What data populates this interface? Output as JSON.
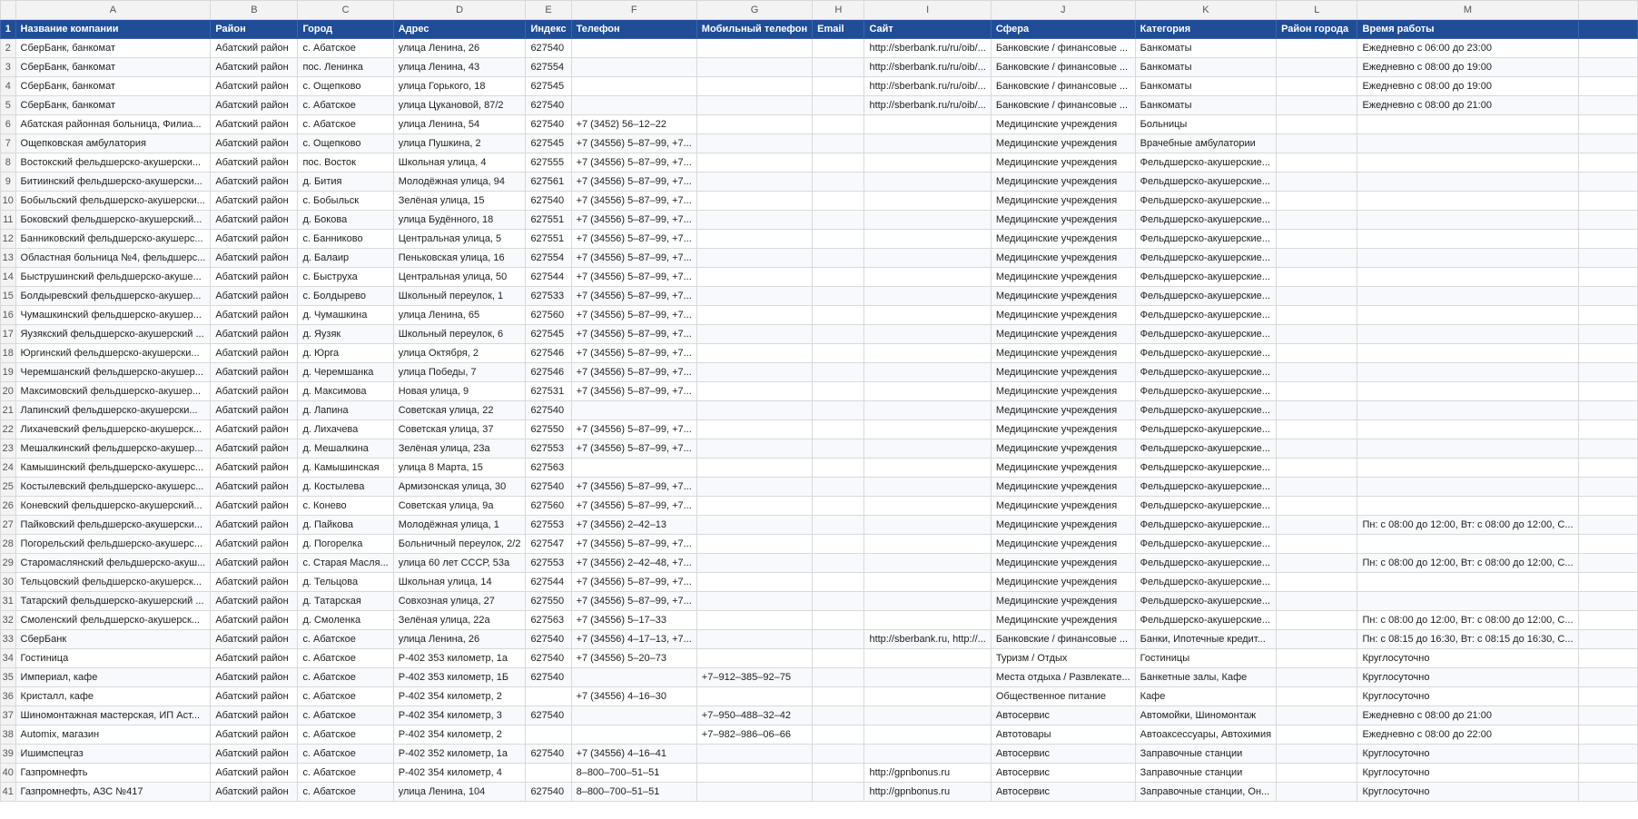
{
  "columns": [
    "A",
    "B",
    "C",
    "D",
    "E",
    "F",
    "G",
    "H",
    "I",
    "J",
    "K",
    "L",
    "M"
  ],
  "header_row": {
    "num": "1",
    "cells": [
      "Название компании",
      "Район",
      "Город",
      "Адрес",
      "Индекс",
      "Телефон",
      "Мобильный телефон",
      "Email",
      "Сайт",
      "Сфера",
      "Категория",
      "Район города",
      "Время работы"
    ]
  },
  "rows": [
    {
      "num": "2",
      "cells": [
        "СберБанк, банкомат",
        "Абатский район",
        "с. Абатское",
        "улица Ленина, 26",
        "627540",
        "",
        "",
        "",
        "http://sberbank.ru/ru/oib/...",
        "Банковские / финансовые ...",
        "Банкоматы",
        "",
        "Ежедневно с 06:00 до 23:00"
      ]
    },
    {
      "num": "3",
      "cells": [
        "СберБанк, банкомат",
        "Абатский район",
        "пос. Ленинка",
        "улица Ленина, 43",
        "627554",
        "",
        "",
        "",
        "http://sberbank.ru/ru/oib/...",
        "Банковские / финансовые ...",
        "Банкоматы",
        "",
        "Ежедневно с 08:00 до 19:00"
      ]
    },
    {
      "num": "4",
      "cells": [
        "СберБанк, банкомат",
        "Абатский район",
        "с. Ощепково",
        "улица Горького, 18",
        "627545",
        "",
        "",
        "",
        "http://sberbank.ru/ru/oib/...",
        "Банковские / финансовые ...",
        "Банкоматы",
        "",
        "Ежедневно с 08:00 до 19:00"
      ]
    },
    {
      "num": "5",
      "cells": [
        "СберБанк, банкомат",
        "Абатский район",
        "с. Абатское",
        "улица Цукановой, 87/2",
        "627540",
        "",
        "",
        "",
        "http://sberbank.ru/ru/oib/...",
        "Банковские / финансовые ...",
        "Банкоматы",
        "",
        "Ежедневно с 08:00 до 21:00"
      ]
    },
    {
      "num": "6",
      "cells": [
        "Абатская районная больница, Филиа...",
        "Абатский район",
        "с. Абатское",
        "улица Ленина, 54",
        "627540",
        "+7 (3452) 56–12–22",
        "",
        "",
        "",
        "Медицинские учреждения",
        "Больницы",
        "",
        ""
      ]
    },
    {
      "num": "7",
      "cells": [
        "Ощепковская амбулатория",
        "Абатский район",
        "с. Ощепково",
        "улица Пушкина, 2",
        "627545",
        "+7 (34556) 5–87–99, +7...",
        "",
        "",
        "",
        "Медицинские учреждения",
        "Врачебные амбулатории",
        "",
        ""
      ]
    },
    {
      "num": "8",
      "cells": [
        "Востокский фельдшерско-акушерски...",
        "Абатский район",
        "пос. Восток",
        "Школьная улица, 4",
        "627555",
        "+7 (34556) 5–87–99, +7...",
        "",
        "",
        "",
        "Медицинские учреждения",
        "Фельдшерско-акушерские...",
        "",
        ""
      ]
    },
    {
      "num": "9",
      "cells": [
        "Битиинский фельдшерско-акушерски...",
        "Абатский район",
        "д. Бития",
        "Молодёжная улица, 94",
        "627561",
        "+7 (34556) 5–87–99, +7...",
        "",
        "",
        "",
        "Медицинские учреждения",
        "Фельдшерско-акушерские...",
        "",
        ""
      ]
    },
    {
      "num": "10",
      "cells": [
        "Бобыльский фельдшерско-акушерски...",
        "Абатский район",
        "с. Бобыльск",
        "Зелёная улица, 15",
        "627540",
        "+7 (34556) 5–87–99, +7...",
        "",
        "",
        "",
        "Медицинские учреждения",
        "Фельдшерско-акушерские...",
        "",
        ""
      ]
    },
    {
      "num": "11",
      "cells": [
        "Боковский фельдшерско-акушерский...",
        "Абатский район",
        "д. Бокова",
        "улица Будённого, 18",
        "627551",
        "+7 (34556) 5–87–99, +7...",
        "",
        "",
        "",
        "Медицинские учреждения",
        "Фельдшерско-акушерские...",
        "",
        ""
      ]
    },
    {
      "num": "12",
      "cells": [
        "Банниковский фельдшерско-акушерс...",
        "Абатский район",
        "с. Банниково",
        "Центральная улица, 5",
        "627551",
        "+7 (34556) 5–87–99, +7...",
        "",
        "",
        "",
        "Медицинские учреждения",
        "Фельдшерско-акушерские...",
        "",
        ""
      ]
    },
    {
      "num": "13",
      "cells": [
        "Областная больница №4, фельдшерс...",
        "Абатский район",
        "д. Балаир",
        "Пеньковская улица, 16",
        "627554",
        "+7 (34556) 5–87–99, +7...",
        "",
        "",
        "",
        "Медицинские учреждения",
        "Фельдшерско-акушерские...",
        "",
        ""
      ]
    },
    {
      "num": "14",
      "cells": [
        "Быструшинский фельдшерско-акуше...",
        "Абатский район",
        "с. Быструха",
        "Центральная улица, 50",
        "627544",
        "+7 (34556) 5–87–99, +7...",
        "",
        "",
        "",
        "Медицинские учреждения",
        "Фельдшерско-акушерские...",
        "",
        ""
      ]
    },
    {
      "num": "15",
      "cells": [
        "Болдыревский фельдшерско-акушер...",
        "Абатский район",
        "с. Болдырево",
        "Школьный переулок, 1",
        "627533",
        "+7 (34556) 5–87–99, +7...",
        "",
        "",
        "",
        "Медицинские учреждения",
        "Фельдшерско-акушерские...",
        "",
        ""
      ]
    },
    {
      "num": "16",
      "cells": [
        "Чумашкинский фельдшерско-акушер...",
        "Абатский район",
        "д. Чумашкина",
        "улица Ленина, 65",
        "627560",
        "+7 (34556) 5–87–99, +7...",
        "",
        "",
        "",
        "Медицинские учреждения",
        "Фельдшерско-акушерские...",
        "",
        ""
      ]
    },
    {
      "num": "17",
      "cells": [
        "Яузякский фельдшерско-акушерский ...",
        "Абатский район",
        "д. Яузяк",
        "Школьный переулок, 6",
        "627545",
        "+7 (34556) 5–87–99, +7...",
        "",
        "",
        "",
        "Медицинские учреждения",
        "Фельдшерско-акушерские...",
        "",
        ""
      ]
    },
    {
      "num": "18",
      "cells": [
        "Юргинский фельдшерско-акушерски...",
        "Абатский район",
        "д. Юрга",
        "улица Октября, 2",
        "627546",
        "+7 (34556) 5–87–99, +7...",
        "",
        "",
        "",
        "Медицинские учреждения",
        "Фельдшерско-акушерские...",
        "",
        ""
      ]
    },
    {
      "num": "19",
      "cells": [
        "Черемшанский фельдшерско-акушер...",
        "Абатский район",
        "д. Черемшанка",
        "улица Победы, 7",
        "627546",
        "+7 (34556) 5–87–99, +7...",
        "",
        "",
        "",
        "Медицинские учреждения",
        "Фельдшерско-акушерские...",
        "",
        ""
      ]
    },
    {
      "num": "20",
      "cells": [
        "Максимовский фельдшерско-акушер...",
        "Абатский район",
        "д. Максимова",
        "Новая улица, 9",
        "627531",
        "+7 (34556) 5–87–99, +7...",
        "",
        "",
        "",
        "Медицинские учреждения",
        "Фельдшерско-акушерские...",
        "",
        ""
      ]
    },
    {
      "num": "21",
      "cells": [
        "Лапинский фельдшерско-акушерски...",
        "Абатский район",
        "д. Лапина",
        "Советская улица, 22",
        "627540",
        "",
        "",
        "",
        "",
        "Медицинские учреждения",
        "Фельдшерско-акушерские...",
        "",
        ""
      ]
    },
    {
      "num": "22",
      "cells": [
        "Лихачевский фельдшерско-акушерск...",
        "Абатский район",
        "д. Лихачева",
        "Советская улица, 37",
        "627550",
        "+7 (34556) 5–87–99, +7...",
        "",
        "",
        "",
        "Медицинские учреждения",
        "Фельдшерско-акушерские...",
        "",
        ""
      ]
    },
    {
      "num": "23",
      "cells": [
        "Мешалкинский фельдшерско-акушер...",
        "Абатский район",
        "д. Мешалкина",
        "Зелёная улица, 23а",
        "627553",
        "+7 (34556) 5–87–99, +7...",
        "",
        "",
        "",
        "Медицинские учреждения",
        "Фельдшерско-акушерские...",
        "",
        ""
      ]
    },
    {
      "num": "24",
      "cells": [
        "Камышинский фельдшерско-акушерс...",
        "Абатский район",
        "д. Камышинская",
        "улица 8 Марта, 15",
        "627563",
        "",
        "",
        "",
        "",
        "Медицинские учреждения",
        "Фельдшерско-акушерские...",
        "",
        ""
      ]
    },
    {
      "num": "25",
      "cells": [
        "Костылевский фельдшерско-акушерс...",
        "Абатский район",
        "д. Костылева",
        "Армизонская улица, 30",
        "627540",
        "+7 (34556) 5–87–99, +7...",
        "",
        "",
        "",
        "Медицинские учреждения",
        "Фельдшерско-акушерские...",
        "",
        ""
      ]
    },
    {
      "num": "26",
      "cells": [
        "Коневский фельдшерско-акушерский...",
        "Абатский район",
        "с. Конево",
        "Советская улица, 9а",
        "627560",
        "+7 (34556) 5–87–99, +7...",
        "",
        "",
        "",
        "Медицинские учреждения",
        "Фельдшерско-акушерские...",
        "",
        ""
      ]
    },
    {
      "num": "27",
      "cells": [
        "Пайковский фельдшерско-акушерски...",
        "Абатский район",
        "д. Пайкова",
        "Молодёжная улица, 1",
        "627553",
        "+7 (34556) 2–42–13",
        "",
        "",
        "",
        "Медицинские учреждения",
        "Фельдшерско-акушерские...",
        "",
        "Пн: с 08:00 до 12:00, Вт: с 08:00 до 12:00, С..."
      ]
    },
    {
      "num": "28",
      "cells": [
        "Погорельский фельдшерско-акушерс...",
        "Абатский район",
        "д. Погорелка",
        "Больничный переулок, 2/2",
        "627547",
        "+7 (34556) 5–87–99, +7...",
        "",
        "",
        "",
        "Медицинские учреждения",
        "Фельдшерско-акушерские...",
        "",
        ""
      ]
    },
    {
      "num": "29",
      "cells": [
        "Старомаслянский фельдшерско-акуш...",
        "Абатский район",
        "с. Старая Масля...",
        "улица 60 лет СССР, 53а",
        "627553",
        "+7 (34556) 2–42–48, +7...",
        "",
        "",
        "",
        "Медицинские учреждения",
        "Фельдшерско-акушерские...",
        "",
        "Пн: с 08:00 до 12:00, Вт: с 08:00 до 12:00, С..."
      ]
    },
    {
      "num": "30",
      "cells": [
        "Тельцовский фельдшерско-акушерск...",
        "Абатский район",
        "д. Тельцова",
        "Школьная улица, 14",
        "627544",
        "+7 (34556) 5–87–99, +7...",
        "",
        "",
        "",
        "Медицинские учреждения",
        "Фельдшерско-акушерские...",
        "",
        ""
      ]
    },
    {
      "num": "31",
      "cells": [
        "Татарский фельдшерско-акушерский ...",
        "Абатский район",
        "д. Татарская",
        "Совхозная улица, 27",
        "627550",
        "+7 (34556) 5–87–99, +7...",
        "",
        "",
        "",
        "Медицинские учреждения",
        "Фельдшерско-акушерские...",
        "",
        ""
      ]
    },
    {
      "num": "32",
      "cells": [
        "Смоленский фельдшерско-акушерск...",
        "Абатский район",
        "д. Смоленка",
        "Зелёная улица, 22а",
        "627563",
        "+7 (34556) 5–17–33",
        "",
        "",
        "",
        "Медицинские учреждения",
        "Фельдшерско-акушерские...",
        "",
        "Пн: с 08:00 до 12:00, Вт: с 08:00 до 12:00, С..."
      ]
    },
    {
      "num": "33",
      "cells": [
        "СберБанк",
        "Абатский район",
        "с. Абатское",
        "улица Ленина, 26",
        "627540",
        "+7 (34556) 4–17–13, +7...",
        "",
        "",
        "http://sberbank.ru, http://...",
        "Банковские / финансовые ...",
        "Банки, Ипотечные кредит...",
        "",
        "Пн: с 08:15 до 16:30, Вт: с 08:15 до 16:30, С..."
      ]
    },
    {
      "num": "34",
      "cells": [
        "Гостиница",
        "Абатский район",
        "с. Абатское",
        "Р-402 353 километр, 1а",
        "627540",
        "+7 (34556) 5–20–73",
        "",
        "",
        "",
        "Туризм / Отдых",
        "Гостиницы",
        "",
        "Круглосуточно"
      ]
    },
    {
      "num": "35",
      "cells": [
        "Империал, кафе",
        "Абатский район",
        "с. Абатское",
        "Р-402 353 километр, 1Б",
        "627540",
        "",
        "+7–912–385–92–75",
        "",
        "",
        "Места отдыха / Развлекате...",
        "Банкетные залы, Кафе",
        "",
        "Круглосуточно"
      ]
    },
    {
      "num": "36",
      "cells": [
        "Кристалл, кафе",
        "Абатский район",
        "с. Абатское",
        "Р-402 354 километр, 2",
        "",
        "+7 (34556) 4–16–30",
        "",
        "",
        "",
        "Общественное питание",
        "Кафе",
        "",
        "Круглосуточно"
      ]
    },
    {
      "num": "37",
      "cells": [
        "Шиномонтажная мастерская, ИП Аст...",
        "Абатский район",
        "с. Абатское",
        "Р-402 354 километр, 3",
        "627540",
        "",
        "+7–950–488–32–42",
        "",
        "",
        "Автосервис",
        "Автомойки, Шиномонтаж",
        "",
        "Ежедневно с 08:00 до 21:00"
      ]
    },
    {
      "num": "38",
      "cells": [
        "Automix, магазин",
        "Абатский район",
        "с. Абатское",
        "Р-402 354 километр, 2",
        "",
        "",
        "+7–982–986–06–66",
        "",
        "",
        "Автотовары",
        "Автоаксессуары, Автохимия",
        "",
        "Ежедневно с 08:00 до 22:00"
      ]
    },
    {
      "num": "39",
      "cells": [
        "Ишимспецгаз",
        "Абатский район",
        "с. Абатское",
        "Р-402 352 километр, 1а",
        "627540",
        "+7 (34556) 4–16–41",
        "",
        "",
        "",
        "Автосервис",
        "Заправочные станции",
        "",
        "Круглосуточно"
      ]
    },
    {
      "num": "40",
      "cells": [
        "Газпромнефть",
        "Абатский район",
        "с. Абатское",
        "Р-402 354 километр, 4",
        "",
        "8–800–700–51–51",
        "",
        "",
        "http://gpnbonus.ru",
        "Автосервис",
        "Заправочные станции",
        "",
        "Круглосуточно"
      ]
    },
    {
      "num": "41",
      "cells": [
        "Газпромнефть, АЗС №417",
        "Абатский район",
        "с. Абатское",
        "улица Ленина, 104",
        "627540",
        "8–800–700–51–51",
        "",
        "",
        "http://gpnbonus.ru",
        "Автосервис",
        "Заправочные станции, Он...",
        "",
        "Круглосуточно"
      ]
    }
  ]
}
